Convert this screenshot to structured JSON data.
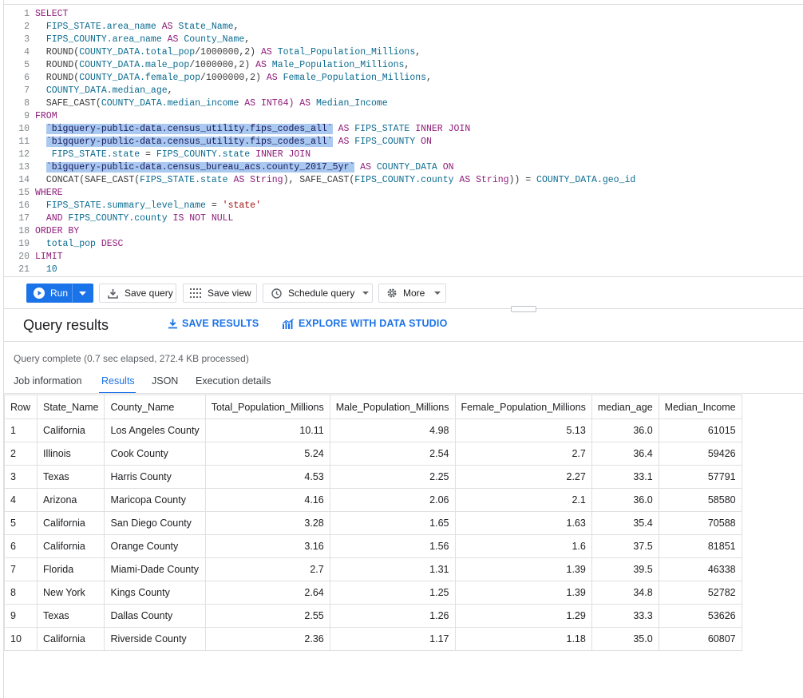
{
  "editor": {
    "lines": [
      [
        {
          "t": "SELECT",
          "c": "kw"
        }
      ],
      [
        {
          "t": "  "
        },
        {
          "t": "FIPS_STATE.area_name",
          "c": "fld"
        },
        {
          "t": " AS ",
          "c": "kw"
        },
        {
          "t": "State_Name",
          "c": "fld"
        },
        {
          "t": ","
        }
      ],
      [
        {
          "t": "  "
        },
        {
          "t": "FIPS_COUNTY.area_name",
          "c": "fld"
        },
        {
          "t": " AS ",
          "c": "kw"
        },
        {
          "t": "County_Name",
          "c": "fld"
        },
        {
          "t": ","
        }
      ],
      [
        {
          "t": "  ROUND("
        },
        {
          "t": "COUNTY_DATA.total_pop",
          "c": "fld"
        },
        {
          "t": "/1000000,2) "
        },
        {
          "t": "AS",
          "c": "kw"
        },
        {
          "t": " Total_Population_Millions",
          "c": "fld"
        },
        {
          "t": ","
        }
      ],
      [
        {
          "t": "  ROUND("
        },
        {
          "t": "COUNTY_DATA.male_pop",
          "c": "fld"
        },
        {
          "t": "/1000000,2) "
        },
        {
          "t": "AS",
          "c": "kw"
        },
        {
          "t": " Male_Population_Millions",
          "c": "fld"
        },
        {
          "t": ","
        }
      ],
      [
        {
          "t": "  ROUND("
        },
        {
          "t": "COUNTY_DATA.female_pop",
          "c": "fld"
        },
        {
          "t": "/1000000,2) "
        },
        {
          "t": "AS",
          "c": "kw"
        },
        {
          "t": " Female_Population_Millions",
          "c": "fld"
        },
        {
          "t": ","
        }
      ],
      [
        {
          "t": "  "
        },
        {
          "t": "COUNTY_DATA.median_age",
          "c": "fld"
        },
        {
          "t": ","
        }
      ],
      [
        {
          "t": "  SAFE_CAST("
        },
        {
          "t": "COUNTY_DATA.median_income",
          "c": "fld"
        },
        {
          "t": " AS INT64) ",
          "c": "kw"
        },
        {
          "t": "AS",
          "c": "kw"
        },
        {
          "t": " Median_Income",
          "c": "fld"
        }
      ],
      [
        {
          "t": "FROM",
          "c": "kw"
        }
      ],
      [
        {
          "t": "  "
        },
        {
          "t": "`bigquery-public-data.census_utility.fips_codes_all`",
          "c": "str"
        },
        {
          "t": " AS ",
          "c": "kw"
        },
        {
          "t": "FIPS_STATE ",
          "c": "fld"
        },
        {
          "t": "INNER JOIN",
          "c": "kw"
        }
      ],
      [
        {
          "t": "  "
        },
        {
          "t": "`bigquery-public-data.census_utility.fips_codes_all`",
          "c": "str"
        },
        {
          "t": " AS ",
          "c": "kw"
        },
        {
          "t": "FIPS_COUNTY ",
          "c": "fld"
        },
        {
          "t": "ON",
          "c": "kw"
        }
      ],
      [
        {
          "t": "   "
        },
        {
          "t": "FIPS_STATE.state",
          "c": "fld"
        },
        {
          "t": " = "
        },
        {
          "t": "FIPS_COUNTY.state ",
          "c": "fld"
        },
        {
          "t": "INNER JOIN",
          "c": "kw"
        }
      ],
      [
        {
          "t": "  "
        },
        {
          "t": "`bigquery-public-data.census_bureau_acs.county_2017_5yr`",
          "c": "str"
        },
        {
          "t": " AS ",
          "c": "kw"
        },
        {
          "t": "COUNTY_DATA ",
          "c": "fld"
        },
        {
          "t": "ON",
          "c": "kw"
        }
      ],
      [
        {
          "t": "  CONCAT(SAFE_CAST("
        },
        {
          "t": "FIPS_STATE.state",
          "c": "fld"
        },
        {
          "t": " AS String",
          "c": "kw"
        },
        {
          "t": "), SAFE_CAST("
        },
        {
          "t": "FIPS_COUNTY.county",
          "c": "fld"
        },
        {
          "t": " AS String",
          "c": "kw"
        },
        {
          "t": ")) = "
        },
        {
          "t": "COUNTY_DATA.geo_id",
          "c": "fld"
        }
      ],
      [
        {
          "t": "WHERE",
          "c": "kw"
        }
      ],
      [
        {
          "t": "  "
        },
        {
          "t": "FIPS_STATE.summary_level_name",
          "c": "fld"
        },
        {
          "t": " = "
        },
        {
          "t": "'state'",
          "c": "lit"
        }
      ],
      [
        {
          "t": "  "
        },
        {
          "t": "AND ",
          "c": "kw"
        },
        {
          "t": "FIPS_COUNTY.county ",
          "c": "fld"
        },
        {
          "t": "IS NOT NULL",
          "c": "kw"
        }
      ],
      [
        {
          "t": "ORDER BY",
          "c": "kw"
        }
      ],
      [
        {
          "t": "  "
        },
        {
          "t": "total_pop ",
          "c": "fld"
        },
        {
          "t": "DESC",
          "c": "kw"
        }
      ],
      [
        {
          "t": "LIMIT",
          "c": "kw"
        }
      ],
      [
        {
          "t": "  "
        },
        {
          "t": "10",
          "c": "fld"
        }
      ]
    ]
  },
  "toolbar": {
    "run": "Run",
    "save_query": "Save query",
    "save_view": "Save view",
    "schedule_query": "Schedule query",
    "more": "More"
  },
  "results": {
    "title": "Query results",
    "save_results": "SAVE RESULTS",
    "explore": "EXPLORE WITH DATA STUDIO",
    "status": "Query complete (0.7 sec elapsed, 272.4 KB processed)",
    "tabs": [
      "Job information",
      "Results",
      "JSON",
      "Execution details"
    ],
    "active_tab": "Results",
    "columns": [
      "Row",
      "State_Name",
      "County_Name",
      "Total_Population_Millions",
      "Male_Population_Millions",
      "Female_Population_Millions",
      "median_age",
      "Median_Income"
    ],
    "rows": [
      [
        "1",
        "California",
        "Los Angeles County",
        "10.11",
        "4.98",
        "5.13",
        "36.0",
        "61015"
      ],
      [
        "2",
        "Illinois",
        "Cook County",
        "5.24",
        "2.54",
        "2.7",
        "36.4",
        "59426"
      ],
      [
        "3",
        "Texas",
        "Harris County",
        "4.53",
        "2.25",
        "2.27",
        "33.1",
        "57791"
      ],
      [
        "4",
        "Arizona",
        "Maricopa County",
        "4.16",
        "2.06",
        "2.1",
        "36.0",
        "58580"
      ],
      [
        "5",
        "California",
        "San Diego County",
        "3.28",
        "1.65",
        "1.63",
        "35.4",
        "70588"
      ],
      [
        "6",
        "California",
        "Orange County",
        "3.16",
        "1.56",
        "1.6",
        "37.5",
        "81851"
      ],
      [
        "7",
        "Florida",
        "Miami-Dade County",
        "2.7",
        "1.31",
        "1.39",
        "39.5",
        "46338"
      ],
      [
        "8",
        "New York",
        "Kings County",
        "2.64",
        "1.25",
        "1.39",
        "34.8",
        "52782"
      ],
      [
        "9",
        "Texas",
        "Dallas County",
        "2.55",
        "1.26",
        "1.29",
        "33.3",
        "53626"
      ],
      [
        "10",
        "California",
        "Riverside County",
        "2.36",
        "1.17",
        "1.18",
        "35.0",
        "60807"
      ]
    ]
  },
  "colors": {
    "accent": "#1a73e8",
    "keyword": "#8f1b7a",
    "field": "#0b6b8f",
    "highlight": "#aac9f0"
  }
}
